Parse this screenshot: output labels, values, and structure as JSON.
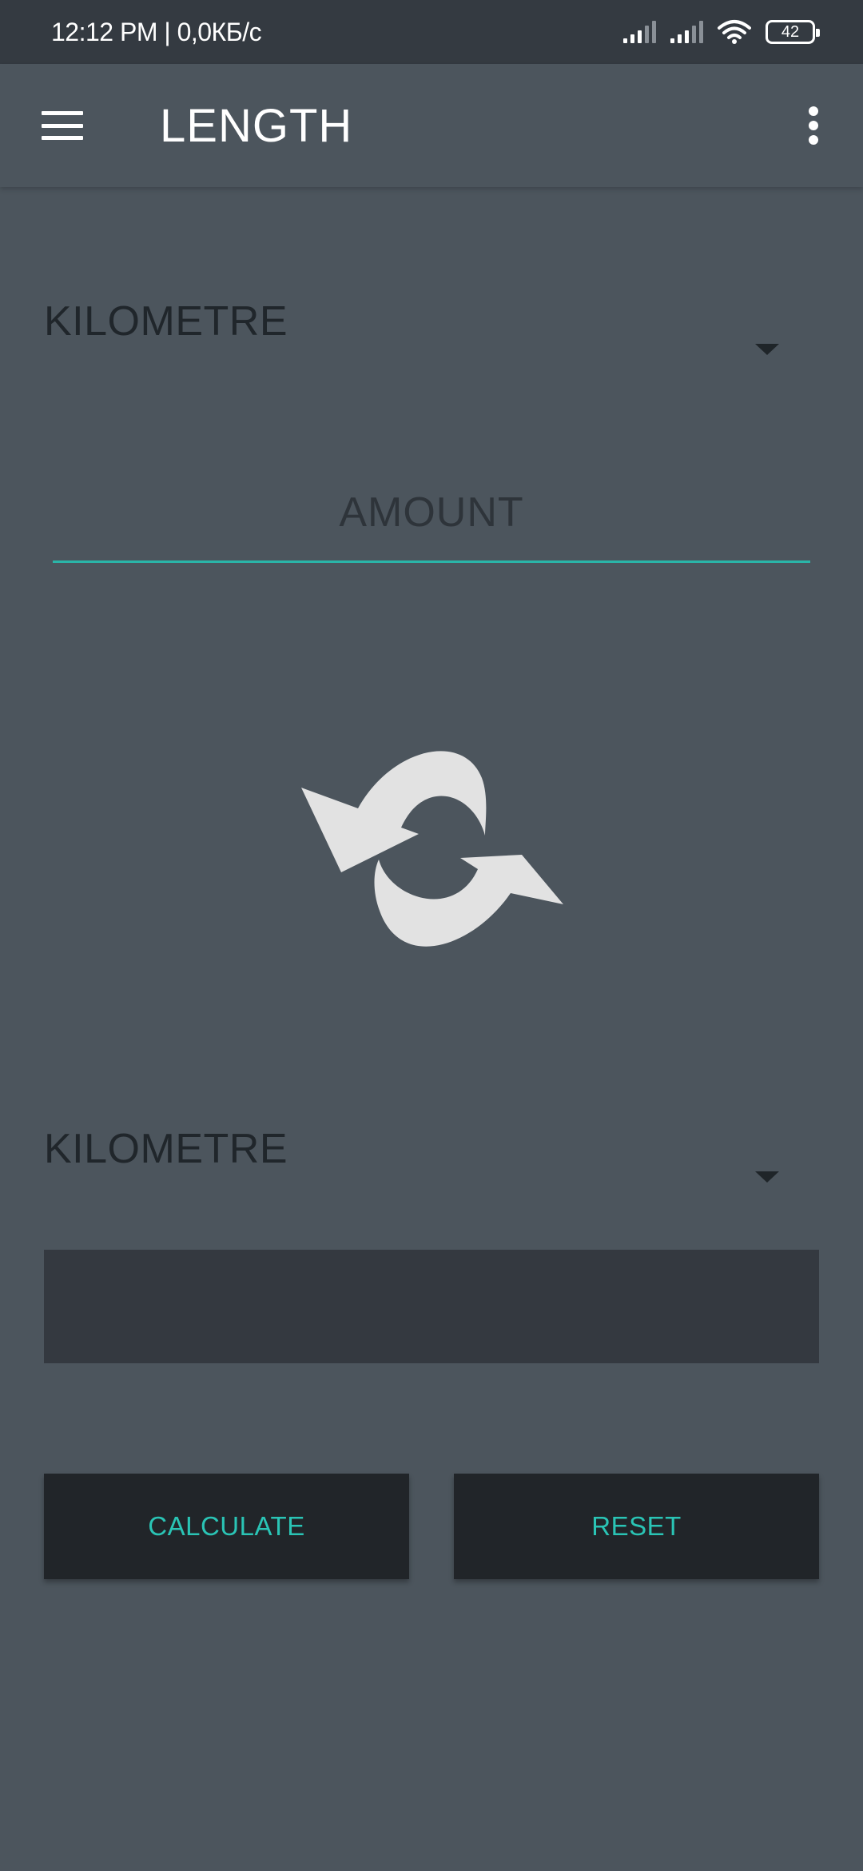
{
  "status_bar": {
    "time_speed": "12:12 PM | 0,0КБ/с",
    "battery": "42"
  },
  "app_bar": {
    "title": "LENGTH"
  },
  "from_unit": {
    "selected": "KILOMETRE"
  },
  "amount": {
    "placeholder": "AMOUNT",
    "value": ""
  },
  "to_unit": {
    "selected": "KILOMETRE"
  },
  "result": {
    "value": ""
  },
  "buttons": {
    "calculate": "CALCULATE",
    "reset": "RESET"
  },
  "colors": {
    "background": "#4c555d",
    "status_bar": "#343a41",
    "accent": "#2ac4b5",
    "button_bg": "#212529",
    "result_bg": "#343940"
  }
}
